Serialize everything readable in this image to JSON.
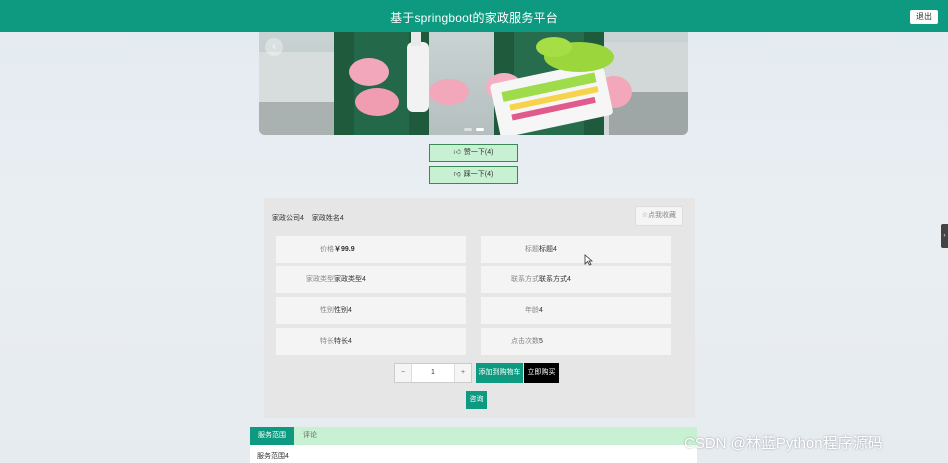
{
  "header": {
    "title": "基于springboot的家政服务平台",
    "logout_label": "退出"
  },
  "banner": {
    "prev_icon": "chevron-left-icon",
    "slides": 2,
    "active_slide": 1
  },
  "votes": {
    "up_label": "赞一下(4)",
    "up_icon": "thumbs-up-icon",
    "down_label": "踩一下(4)",
    "down_icon": "thumbs-down-icon"
  },
  "detail": {
    "company": "家政公司4",
    "name": "家政姓名4",
    "favorite_label": "点我收藏",
    "fields": [
      {
        "label": "价格",
        "value": "￥99.9"
      },
      {
        "label": "标题",
        "value": "标题4"
      },
      {
        "label": "家政类型",
        "value": "家政类型4"
      },
      {
        "label": "联系方式",
        "value": "联系方式4"
      },
      {
        "label": "性别",
        "value": "性别4"
      },
      {
        "label": "年龄",
        "value": "4"
      },
      {
        "label": "特长",
        "value": "特长4"
      },
      {
        "label": "点击次数",
        "value": "5"
      }
    ],
    "quantity": {
      "minus": "−",
      "value": "1",
      "plus": "+"
    },
    "add_to_cart_label": "添加到购物车",
    "buy_now_label": "立即购买",
    "consult_label": "咨询"
  },
  "tabs": {
    "items": [
      {
        "label": "服务范围"
      },
      {
        "label": "评论"
      }
    ],
    "active_content": "服务范围4"
  },
  "side_handle_glyph": "‹",
  "watermark": "CSDN @林蓝Python程序源码",
  "colors": {
    "primary": "#0e9a80",
    "light_green": "#c8f0d2",
    "black_button": "#000000"
  }
}
